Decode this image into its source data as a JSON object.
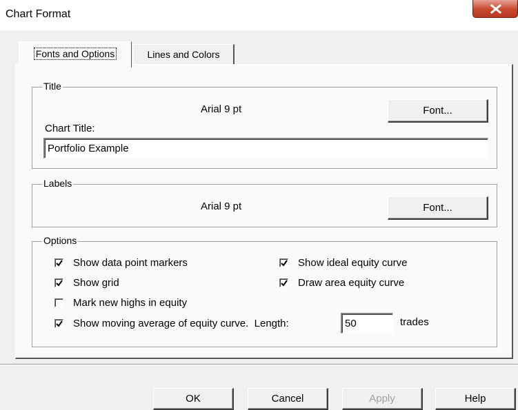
{
  "window": {
    "title": "Chart Format"
  },
  "tabs": [
    {
      "label": "Fonts and Options",
      "active": true
    },
    {
      "label": "Lines and Colors",
      "active": false
    }
  ],
  "title_group": {
    "label": "Title",
    "font_desc": "Arial 9 pt",
    "font_button": "Font...",
    "chart_title_label": "Chart Title:",
    "chart_title_value": "Portfolio Example"
  },
  "labels_group": {
    "label": "Labels",
    "font_desc": "Arial 9 pt",
    "font_button": "Font..."
  },
  "options_group": {
    "label": "Options",
    "show_data_point_markers": {
      "label": "Show data point markers",
      "checked": true
    },
    "show_ideal_equity_curve": {
      "label": "Show ideal equity curve",
      "checked": true
    },
    "show_grid": {
      "label": "Show grid",
      "checked": true
    },
    "draw_area_equity_curve": {
      "label": "Draw area equity curve",
      "checked": true
    },
    "mark_new_highs": {
      "label": "Mark new highs in equity",
      "checked": false
    },
    "moving_average": {
      "label": "Show moving average of equity curve.  Length:",
      "checked": true,
      "length_value": "50",
      "unit": "trades"
    }
  },
  "footer": {
    "ok": "OK",
    "cancel": "Cancel",
    "apply": "Apply",
    "help": "Help"
  }
}
